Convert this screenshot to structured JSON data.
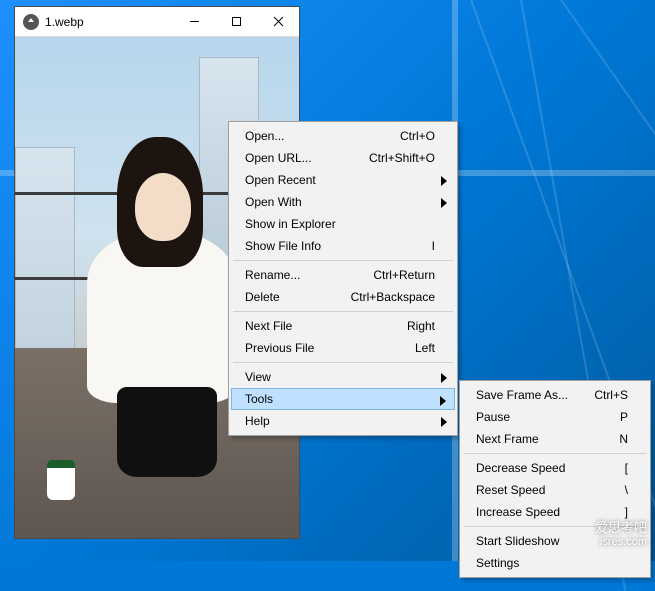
{
  "window": {
    "title": "1.webp"
  },
  "context_menu": {
    "open": "Open...",
    "open_sc": "Ctrl+O",
    "open_url": "Open URL...",
    "open_url_sc": "Ctrl+Shift+O",
    "open_recent": "Open Recent",
    "open_with": "Open With",
    "show_explorer": "Show in Explorer",
    "show_info": "Show File Info",
    "show_info_sc": "I",
    "rename": "Rename...",
    "rename_sc": "Ctrl+Return",
    "delete": "Delete",
    "delete_sc": "Ctrl+Backspace",
    "next_file": "Next File",
    "next_file_sc": "Right",
    "prev_file": "Previous File",
    "prev_file_sc": "Left",
    "view": "View",
    "tools": "Tools",
    "help": "Help"
  },
  "tools_submenu": {
    "save_frame": "Save Frame As...",
    "save_frame_sc": "Ctrl+S",
    "pause": "Pause",
    "pause_sc": "P",
    "next_frame": "Next Frame",
    "next_frame_sc": "N",
    "dec_speed": "Decrease Speed",
    "dec_speed_sc": "[",
    "reset_speed": "Reset Speed",
    "reset_speed_sc": "\\",
    "inc_speed": "Increase Speed",
    "inc_speed_sc": "]",
    "start_slideshow": "Start Slideshow",
    "settings": "Settings"
  },
  "watermark": {
    "line1": "爱思考吧",
    "line2": "isres.com"
  }
}
